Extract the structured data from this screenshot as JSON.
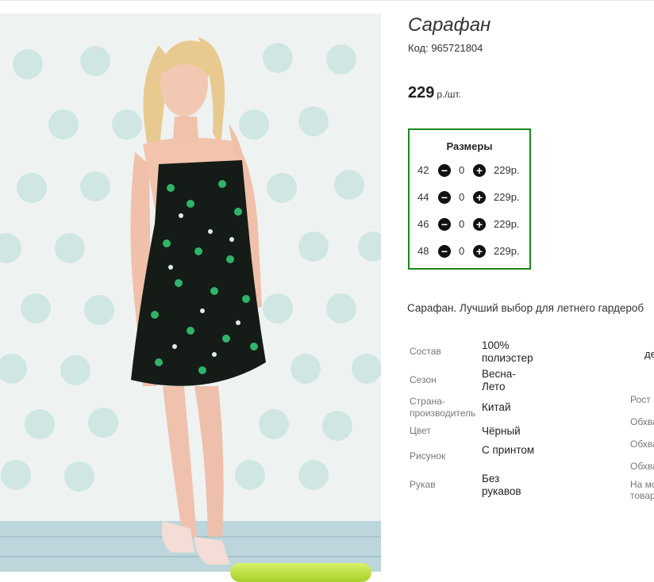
{
  "product": {
    "title": "Сарафан",
    "code": "Код: 965721804",
    "price": "229",
    "price_unit": "р./шт."
  },
  "sizes": {
    "header": "Размеры",
    "rows": [
      {
        "size": "42",
        "qty": "0",
        "price": "229р."
      },
      {
        "size": "44",
        "qty": "0",
        "price": "229р."
      },
      {
        "size": "46",
        "qty": "0",
        "price": "229р."
      },
      {
        "size": "48",
        "qty": "0",
        "price": "229р."
      }
    ],
    "minus_icon": "minus-circle-icon",
    "plus_icon": "plus-circle-icon",
    "border_color": "#1a8a1a"
  },
  "description": "Сарафан. Лучший выбор для летнего гардероб",
  "attributes": [
    {
      "label": "Состав",
      "value": "100% полиэстер"
    },
    {
      "label": "Сезон",
      "value": "Весна-Лето"
    },
    {
      "label": "Страна-производитель",
      "value": "Китай"
    },
    {
      "label": "Цвет",
      "value": "Чёрный"
    },
    {
      "label": "Рисунок",
      "value": "С принтом"
    },
    {
      "label": "Рукав",
      "value": "Без рукавов"
    }
  ],
  "side_attributes": {
    "top_value": "де",
    "labels": [
      "Рост",
      "Обхва",
      "Обхва",
      "Обхва",
      "На мо",
      "товар"
    ]
  }
}
